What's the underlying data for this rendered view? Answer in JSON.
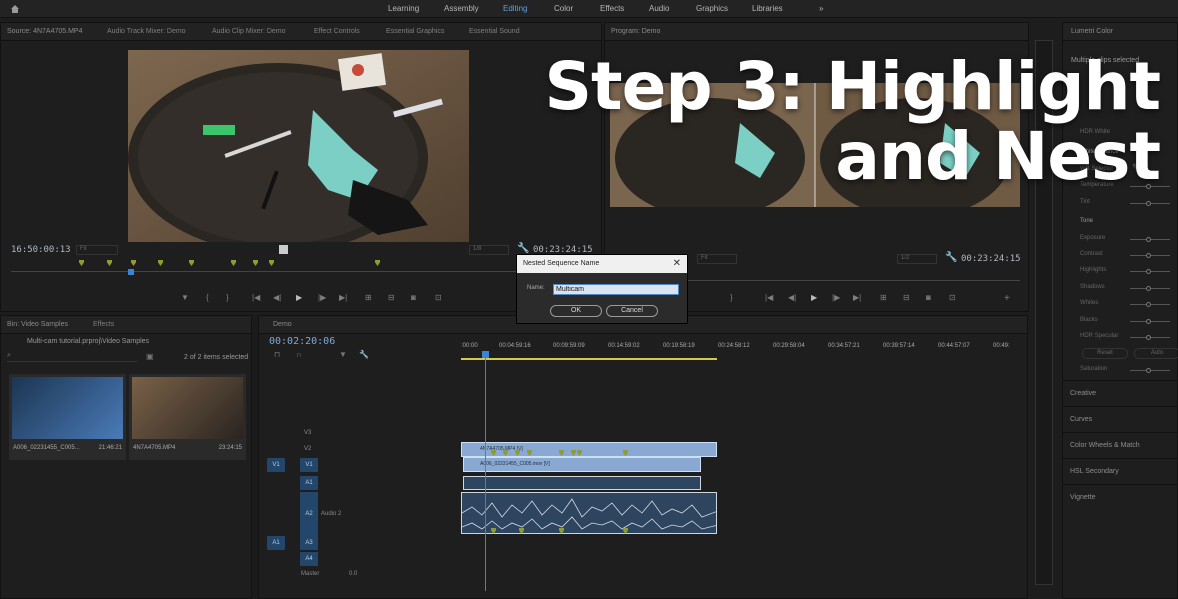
{
  "workspaces": {
    "tabs": [
      "Learning",
      "Assembly",
      "Editing",
      "Color",
      "Effects",
      "Audio",
      "Graphics",
      "Libraries"
    ],
    "active": "Editing",
    "more": "»"
  },
  "source": {
    "tabs": [
      "Source: 4N7A4705.MP4",
      "Audio Track Mixer: Demo",
      "Audio Clip Mixer: Demo",
      "Effect Controls",
      "Essential Graphics",
      "Essential Sound"
    ],
    "timecode_in": "16:50:00:13",
    "fit": "Fit",
    "resolution": "1/8",
    "timecode_out": "00:23:24:15"
  },
  "program": {
    "tab": "Program: Demo",
    "fit": "Fit",
    "zoom": "1/2",
    "timecode_out": "00:23:24:15"
  },
  "project": {
    "tabs": [
      "Bin: Video Samples",
      "Effects"
    ],
    "path": "Multi-cam tutorial.prproj\\Video Samples",
    "selection": "2 of 2 items selected",
    "items": [
      {
        "name": "A006_02231455_C005...",
        "duration": "21:46:21"
      },
      {
        "name": "4N7A4705.MP4",
        "duration": "23:24:15"
      }
    ]
  },
  "timeline": {
    "tab": "Demo",
    "timecode": "00:02:20:06",
    "ruler": [
      ":00:00",
      "00:04:59:16",
      "00:09:59:09",
      "00:14:59:02",
      "00:19:58:19",
      "00:24:58:12",
      "00:29:58:04",
      "00:34:57:21",
      "00:39:57:14",
      "00:44:57:07",
      "00:49:"
    ],
    "tracks": {
      "video": [
        "V3",
        "V2",
        "V1"
      ],
      "audio": [
        "A1",
        "A2",
        "A3",
        "A4"
      ],
      "source_v": "V1",
      "source_a": "A1",
      "audio2_name": "Audio 2",
      "master": "Master",
      "master_val": "0.0"
    },
    "clips": {
      "v2": "4N7A4705.MP4 [V]",
      "v1": "A006_02231455_C005.mov [V]"
    }
  },
  "lumetri": {
    "tab": "Lumetri Color",
    "selection": "Multiple clips selected",
    "hdr_white": "HDR White",
    "white_balance": "White Balance",
    "wb_rows": [
      "WB Selector",
      "Temperature",
      "Tint"
    ],
    "tone": "Tone",
    "tone_rows": [
      "Exposure",
      "Contrast",
      "Highlights",
      "Shadows",
      "Whites",
      "Blacks",
      "HDR Specular"
    ],
    "reset": "Reset",
    "auto": "Auto",
    "saturation": "Saturation",
    "sections": [
      "Creative",
      "Curves",
      "Color Wheels & Match",
      "HSL Secondary",
      "Vignette"
    ]
  },
  "dialog": {
    "title": "Nested Sequence Name",
    "name_label": "Name:",
    "name_value": "Multicam",
    "ok": "OK",
    "cancel": "Cancel"
  },
  "overlay": {
    "line1": "Step 3: Highlight",
    "line2": "and Nest"
  },
  "colors": {
    "accent": "#5aa0e6",
    "clip_video": "#8aa9d2",
    "clip_audio": "#2e4560",
    "marker": "#8f9c2e",
    "playhead": "#3b83d6"
  }
}
